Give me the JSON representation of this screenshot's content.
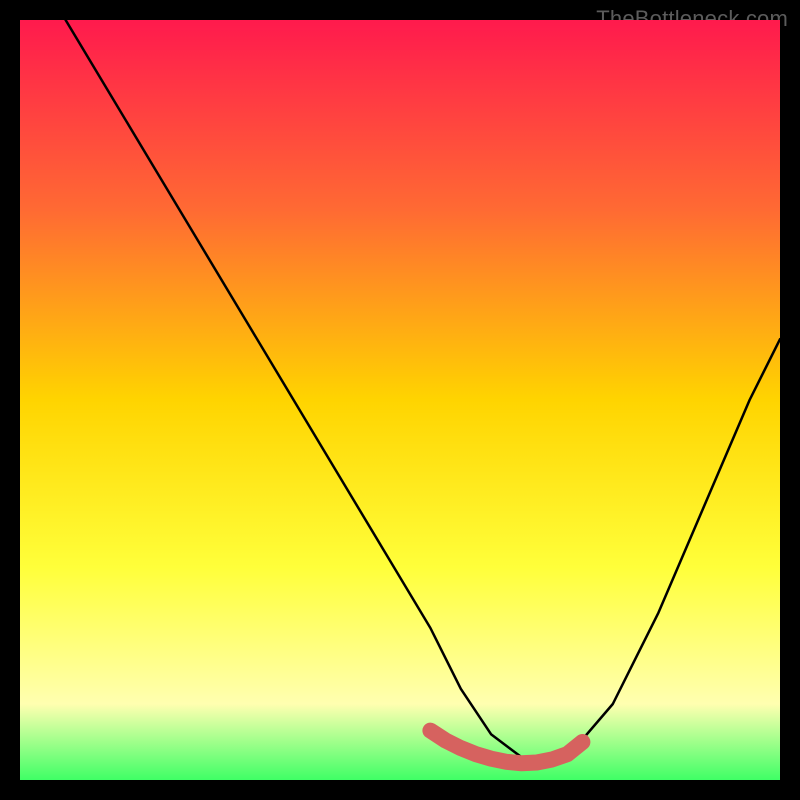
{
  "attribution": "TheBottleneck.com",
  "chart_data": {
    "type": "line",
    "title": "",
    "xlabel": "",
    "ylabel": "",
    "xlim": [
      0,
      100
    ],
    "ylim": [
      0,
      100
    ],
    "background_gradient": [
      "#ff1a4d",
      "#ff6a33",
      "#ffd400",
      "#ffff3a",
      "#ffffb0",
      "#3fff66"
    ],
    "series": [
      {
        "name": "bottleneck-curve",
        "color": "#000000",
        "x": [
          6,
          12,
          18,
          24,
          30,
          36,
          42,
          48,
          54,
          58,
          62,
          66,
          68,
          72,
          78,
          84,
          90,
          96,
          100
        ],
        "y": [
          100,
          90,
          80,
          70,
          60,
          50,
          40,
          30,
          20,
          12,
          6,
          3,
          2,
          3,
          10,
          22,
          36,
          50,
          58
        ]
      }
    ],
    "highlight": {
      "name": "valley-marker",
      "color": "#d6625f",
      "x": [
        54,
        56,
        58,
        60,
        62,
        64,
        66,
        68,
        70,
        72,
        74
      ],
      "y": [
        6.5,
        5.2,
        4.2,
        3.4,
        2.8,
        2.4,
        2.2,
        2.3,
        2.7,
        3.4,
        5.0
      ]
    }
  }
}
